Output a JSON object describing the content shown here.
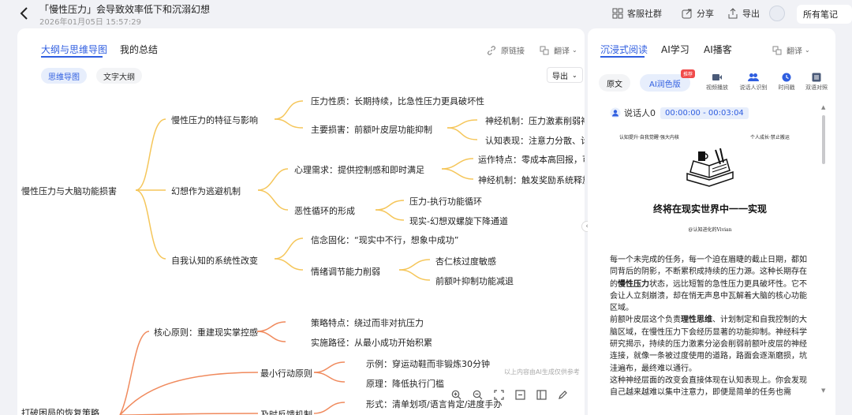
{
  "header": {
    "title": "「慢性压力」会导致效率低下和沉溺幻想",
    "date": "2026年01月05日 15:57:29",
    "service_group": "客服社群",
    "share": "分享",
    "export": "导出",
    "all_notes": "所有笔记"
  },
  "left": {
    "tabs": [
      "大纲与思维导图",
      "我的总结"
    ],
    "original_link": "原链接",
    "translate": "翻译",
    "view_mindmap": "思维导图",
    "view_text": "文字大纲",
    "export": "导出",
    "hint": "以上内容由AI生成仅供参考"
  },
  "mindmap": {
    "root": "慢性压力与大脑功能损害",
    "branches": [
      "慢性压力的特征与影响",
      "幻想作为逃避机制",
      "自我认知的系统性改变",
      "核心原则：重建现实掌控感",
      "最小行动原则",
      "及时反馈机制",
      "打破困局的恢复策略"
    ],
    "leaves": [
      "压力性质：长期持续，比急性压力更具破坏性",
      "主要损害：前额叶皮层功能抑制",
      "神经机制：压力激素削弱神",
      "认知表现：注意力分散、计",
      "心理需求：提供控制感和即时满足",
      "运作特点：零成本高回报，可",
      "神经机制：触发奖励系统释放",
      "恶性循环的形成",
      "压力-执行功能循环",
      "现实-幻想双螺旋下降通道",
      "信念固化：“现实中不行，想象中成功”",
      "情绪调节能力削弱",
      "杏仁核过度敏感",
      "前额叶抑制功能减退",
      "策略特点：绕过而非对抗压力",
      "实施路径：从最小成功开始积累",
      "示例：穿运动鞋而非锻炼30分钟",
      "原理：降低执行门槛",
      "形式：清单划项/语言肯定/进度手办"
    ]
  },
  "right": {
    "tabs": [
      "沉浸式阅读",
      "AI学习",
      "AI播客"
    ],
    "translate": "翻译",
    "original": "原文",
    "ai_polish": "AI润色版",
    "badge": "推荐",
    "tools": [
      "视频播放",
      "说话人识别",
      "时间戳",
      "双语对照"
    ],
    "speaker": "说话人0",
    "time": "00:00:00 - 00:03:04",
    "cover_left": "认知提升·自我觉醒·强大内核",
    "cover_right": "个人成长·禁止搬运",
    "cover_title": "终将在现实世界中一一实现",
    "cover_author": "@认知进化的Vivian",
    "p1a": "每一个未完成的任务，每一个迫在眉睫的截止日期，都如同背后的阴影，不断累积成持续的压力源。这种长期存在的",
    "p1b": "慢性压力",
    "p1c": "状态，远比短暂的急性压力更具破坏性。它不会让人立刻崩溃，却在悄无声息中瓦解着大脑的核心功能区域。",
    "p2a": "前额叶皮层这个负责",
    "p2b": "理性思维",
    "p2c": "、计划制定和自我控制的大脑区域，在慢性压力下会经历显著的功能抑制。神经科学研究揭示，持续的压力激素分泌会削弱前额叶皮层的神经连接，就像一条被过度使用的道路，路面会逐渐磨损，坑洼遍布，最终难以通行。",
    "p3": "这种神经层面的改变会直接体现在认知表现上。你会发现自己越来越难以集中注意力，即便是简单的任务也需"
  }
}
